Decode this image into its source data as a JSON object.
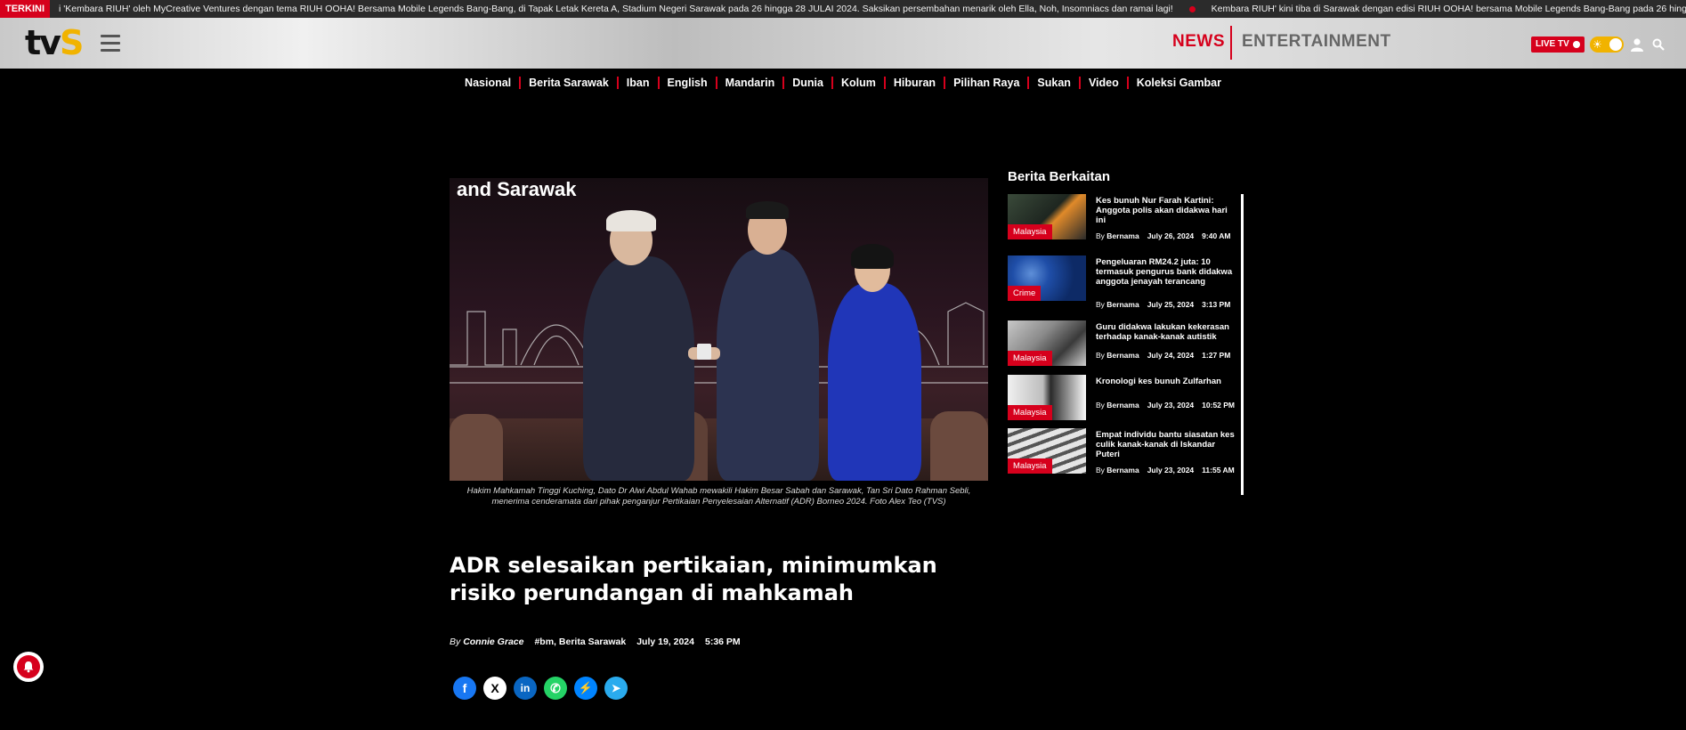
{
  "ticker": {
    "label": "TERKINI",
    "items": [
      "i 'Kembara RIUH' oleh MyCreative Ventures dengan tema RIUH OOHA! Bersama Mobile Legends Bang-Bang, di Tapak Letak Kereta A, Stadium Negeri Sarawak pada 26 hingga 28 JULAI 2024. Saksikan persembahan menarik oleh Ella, Noh, Insomniacs dan ramai lagi!",
      "Kembara RIUH' kini tiba di Sarawak dengan edisi RIUH OOHA! bersama Mobile Legends Bang-Bang pada 26 hingga"
    ]
  },
  "header": {
    "logo": {
      "t": "t",
      "v": "v",
      "s": "S"
    },
    "news_label": "NEWS",
    "entertainment_label": "ENTERTAINMENT",
    "live_label": "LIVE TV",
    "accent": "#d6001c"
  },
  "nav": {
    "items": [
      "Nasional",
      "Berita Sarawak",
      "Iban",
      "English",
      "Mandarin",
      "Dunia",
      "Kolum",
      "Hiburan",
      "Pilihan Raya",
      "Sukan",
      "Video",
      "Koleksi Gambar"
    ]
  },
  "article": {
    "image_sign": "and Sarawak",
    "caption": "Hakim Mahkamah Tinggi Kuching, Dato Dr Alwi Abdul Wahab mewakili Hakim Besar Sabah dan Sarawak, Tan Sri Dato Rahman Sebli, menerima cenderamata dari pihak penganjur Pertikaian Penyelesaian Alternatif (ADR) Borneo 2024. Foto Alex Teo (TVS)",
    "title": "ADR selesaikan pertikaian, minimumkan risiko perundangan di mahkamah",
    "by": "By",
    "author": "Connie Grace",
    "tags": "#bm, Berita Sarawak",
    "date": "July 19, 2024",
    "time": "5:36 PM"
  },
  "share": {
    "facebook": "f",
    "x": "X",
    "linkedin": "in",
    "whatsapp": "✆",
    "messenger": "⚡",
    "telegram": "➤"
  },
  "sidebar": {
    "title": "Berita Berkaitan",
    "items": [
      {
        "title": "Kes bunuh Nur Farah Kartini: Anggota polis akan didakwa hari ini",
        "badge": "Malaysia",
        "by": "By",
        "author": "Bernama",
        "date": "July 26, 2024",
        "time": "9:40 AM"
      },
      {
        "title": "Pengeluaran RM24.2 juta: 10 termasuk pengurus bank didakwa anggota jenayah terancang",
        "badge": "Crime",
        "by": "By",
        "author": "Bernama",
        "date": "July 25, 2024",
        "time": "3:13 PM"
      },
      {
        "title": "Guru didakwa lakukan kekerasan terhadap kanak-kanak autistik",
        "badge": "Malaysia",
        "by": "By",
        "author": "Bernama",
        "date": "July 24, 2024",
        "time": "1:27 PM"
      },
      {
        "title": "Kronologi kes bunuh Zulfarhan",
        "badge": "Malaysia",
        "by": "By",
        "author": "Bernama",
        "date": "July 23, 2024",
        "time": "10:52 PM"
      },
      {
        "title": "Empat individu bantu siasatan kes culik kanak-kanak di Iskandar Puteri",
        "badge": "Malaysia",
        "by": "By",
        "author": "Bernama",
        "date": "July 23, 2024",
        "time": "11:55 AM"
      }
    ]
  }
}
